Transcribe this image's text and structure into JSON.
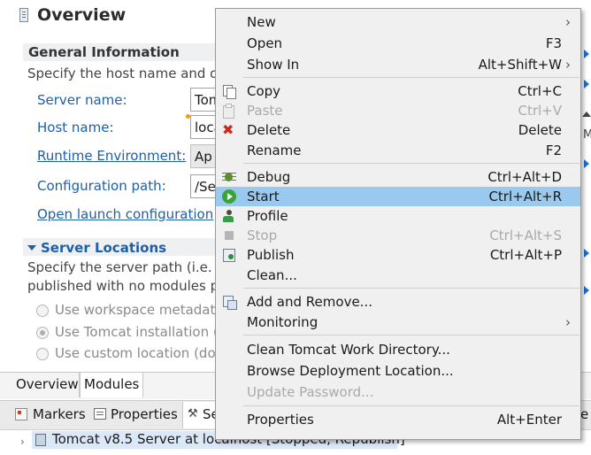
{
  "editor": {
    "title": "Overview",
    "general_info": {
      "heading": "General Information",
      "description": "Specify the host name and ot",
      "server_name_label": "Server name:",
      "server_name_value": "Tom",
      "host_name_label": "Host name:",
      "host_name_value": "loca",
      "runtime_env_link": "Runtime Environment:",
      "runtime_env_value": "Ap",
      "config_path_label": "Configuration path:",
      "config_path_value": "/Se",
      "launch_config_link": "Open launch configuration"
    },
    "server_locations": {
      "heading": "Server Locations",
      "desc_line1": "Specify the server path (i.e. ca",
      "desc_line2": "published with no modules p",
      "options": [
        "Use workspace metadata",
        "Use Tomcat installation (t",
        "Use custom location (doe"
      ],
      "selected_index": 1
    },
    "tabs": [
      "Overview",
      "Modules"
    ],
    "active_tab": "Modules"
  },
  "views": {
    "tabs": [
      "Markers",
      "Properties",
      "Se"
    ],
    "overflow_label": "e",
    "servers": [
      {
        "label": "Tomcat v8.5 Server at localhost  [Stopped, Republish]"
      }
    ]
  },
  "context_menu": {
    "groups": [
      [
        {
          "label": "New",
          "shortcut": "",
          "submenu": true,
          "enabled": true,
          "icon": ""
        },
        {
          "label": "Open",
          "shortcut": "F3",
          "submenu": false,
          "enabled": true,
          "icon": ""
        },
        {
          "label": "Show In",
          "shortcut": "Alt+Shift+W",
          "submenu": true,
          "enabled": true,
          "icon": ""
        }
      ],
      [
        {
          "label": "Copy",
          "shortcut": "Ctrl+C",
          "submenu": false,
          "enabled": true,
          "icon": "copy-icon"
        },
        {
          "label": "Paste",
          "shortcut": "Ctrl+V",
          "submenu": false,
          "enabled": false,
          "icon": "paste-icon"
        },
        {
          "label": "Delete",
          "shortcut": "Delete",
          "submenu": false,
          "enabled": true,
          "icon": "delete-icon"
        },
        {
          "label": "Rename",
          "shortcut": "F2",
          "submenu": false,
          "enabled": true,
          "icon": ""
        }
      ],
      [
        {
          "label": "Debug",
          "shortcut": "Ctrl+Alt+D",
          "submenu": false,
          "enabled": true,
          "icon": "debug-icon"
        },
        {
          "label": "Start",
          "shortcut": "Ctrl+Alt+R",
          "submenu": false,
          "enabled": true,
          "icon": "start-icon",
          "highlighted": true
        },
        {
          "label": "Profile",
          "shortcut": "",
          "submenu": false,
          "enabled": true,
          "icon": "profile-icon"
        },
        {
          "label": "Stop",
          "shortcut": "Ctrl+Alt+S",
          "submenu": false,
          "enabled": false,
          "icon": "stop-icon"
        },
        {
          "label": "Publish",
          "shortcut": "Ctrl+Alt+P",
          "submenu": false,
          "enabled": true,
          "icon": "publish-icon"
        },
        {
          "label": "Clean...",
          "shortcut": "",
          "submenu": false,
          "enabled": true,
          "icon": ""
        }
      ],
      [
        {
          "label": "Add and Remove...",
          "shortcut": "",
          "submenu": false,
          "enabled": true,
          "icon": "add-remove-icon"
        },
        {
          "label": "Monitoring",
          "shortcut": "",
          "submenu": true,
          "enabled": true,
          "icon": ""
        }
      ],
      [
        {
          "label": "Clean Tomcat Work Directory...",
          "shortcut": "",
          "submenu": false,
          "enabled": true,
          "icon": ""
        },
        {
          "label": "Browse Deployment Location...",
          "shortcut": "",
          "submenu": false,
          "enabled": true,
          "icon": ""
        },
        {
          "label": "Update Password...",
          "shortcut": "",
          "submenu": false,
          "enabled": false,
          "icon": ""
        }
      ],
      [
        {
          "label": "Properties",
          "shortcut": "Alt+Enter",
          "submenu": false,
          "enabled": true,
          "icon": ""
        }
      ]
    ]
  },
  "colors": {
    "link_blue": "#1d5fa8",
    "menu_highlight": "#99c9ef",
    "menu_background": "#f0f0f0",
    "selected_row": "#dbe8f7"
  }
}
